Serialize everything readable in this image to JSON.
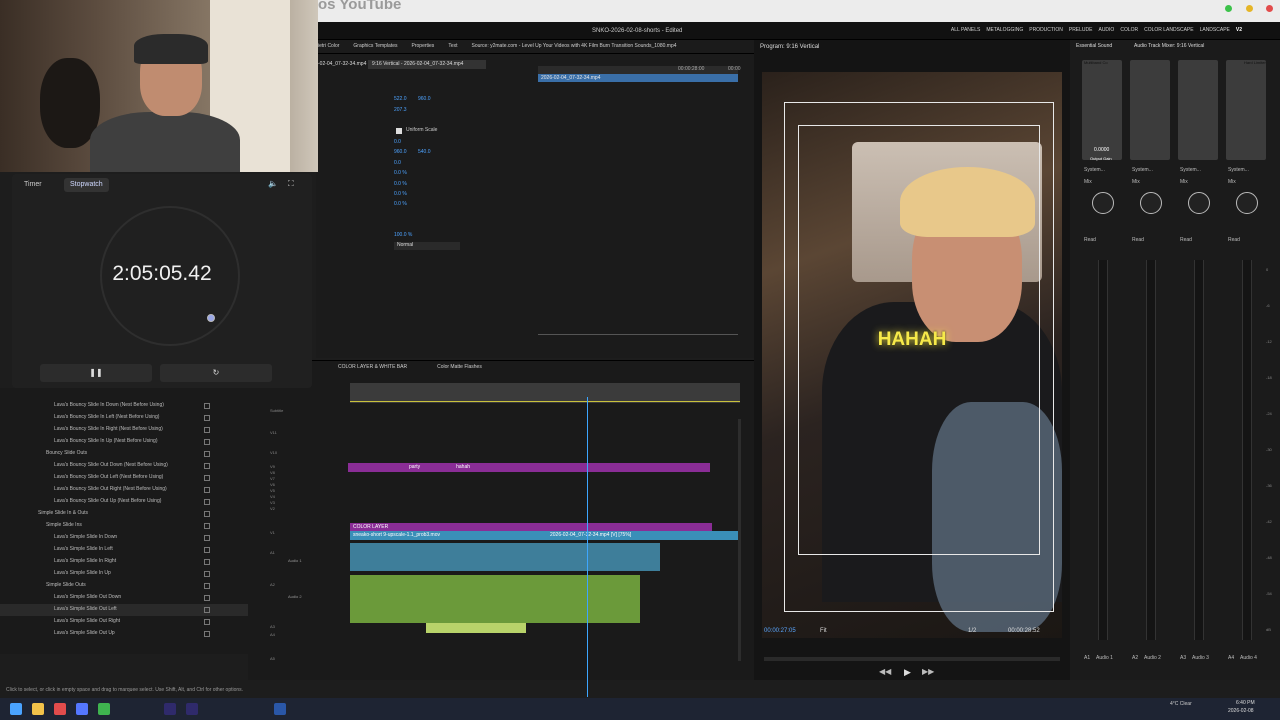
{
  "browser": {
    "tab_title": "os YouTube"
  },
  "app": {
    "title": "SNKO-2026-02-08-shorts - Edited",
    "workspaces": [
      "ALL PANELS",
      "METALOGGING",
      "PRODUCTION",
      "PRELUDE",
      "AUDIO",
      "COLOR",
      "COLOR LANDSCAPE",
      "LANDSCAPE",
      "V2"
    ]
  },
  "timer_widget": {
    "tab_timer": "Timer",
    "tab_stopwatch": "Stopwatch",
    "time": "2:05:05.42",
    "pause_icon": "pause-icon",
    "reset_icon": "reset-icon"
  },
  "effects_panel": {
    "items": [
      {
        "label": "Lava's Bouncy Slide In Down (Nest Before Using)",
        "indent": 2
      },
      {
        "label": "Lava's Bouncy Slide In Left (Nest Before Using)",
        "indent": 2
      },
      {
        "label": "Lava's Bouncy Slide In Right (Nest Before Using)",
        "indent": 2
      },
      {
        "label": "Lava's Bouncy Slide In Up (Nest Before Using)",
        "indent": 2
      },
      {
        "label": "Bouncy Slide Outs",
        "indent": 1
      },
      {
        "label": "Lava's Bouncy Slide Out Down (Nest Before Using)",
        "indent": 2
      },
      {
        "label": "Lava's Bouncy Slide Out Left (Nest Before Using)",
        "indent": 2
      },
      {
        "label": "Lava's Bouncy Slide Out Right (Nest Before Using)",
        "indent": 2
      },
      {
        "label": "Lava's Bouncy Slide Out Up (Nest Before Using)",
        "indent": 2
      },
      {
        "label": "Simple Slide In & Outs",
        "indent": 0
      },
      {
        "label": "Simple Slide Ins",
        "indent": 1
      },
      {
        "label": "Lava's Simple Slide In Down",
        "indent": 2
      },
      {
        "label": "Lava's Simple Slide In Left",
        "indent": 2
      },
      {
        "label": "Lava's Simple Slide In Right",
        "indent": 2
      },
      {
        "label": "Lava's Simple Slide In Up",
        "indent": 2
      },
      {
        "label": "Simple Slide Outs",
        "indent": 1
      },
      {
        "label": "Lava's Simple Slide Out Down",
        "indent": 2
      },
      {
        "label": "Lava's Simple Slide Out Left",
        "indent": 2
      },
      {
        "label": "Lava's Simple Slide Out Right",
        "indent": 2
      },
      {
        "label": "Lava's Simple Slide Out Up",
        "indent": 2
      }
    ]
  },
  "effect_controls": {
    "tabs": [
      "ietri Color",
      "Graphics Templates",
      "Properties",
      "Text",
      "Source: y2mate.com - Level Up Your Videos with 4K Film Burn Transition Sounds_1080.mp4"
    ],
    "clip_path": "9:16 Vertical - 2026-02-04_07-32-34.mp4",
    "clip_short": "-02-04_07-32-34.mp4",
    "mini_clip": "2026-02-04_07-32-34.mp4",
    "mini_times": [
      "00:00:28:00",
      "00:00"
    ],
    "values": [
      "522.0",
      "960.0",
      "207.3",
      "Uniform Scale",
      "0.0",
      "960.0",
      "540.0",
      "0.0",
      "0.0 %",
      "0.0 %",
      "0.0 %",
      "0.0 %",
      "100.0 %",
      "Normal"
    ]
  },
  "timeline": {
    "tabs": [
      "COLOR LAYER & WHITE BAR",
      "Color Matte Flashes"
    ],
    "tracks": [
      "Subtitle",
      "V11",
      "V10",
      "V9",
      "V8",
      "V7",
      "V6",
      "V5",
      "V4",
      "V3",
      "V2",
      "V1",
      "A1",
      "A2",
      "A3",
      "A4",
      "A5"
    ],
    "track_labels": [
      "Audio 1",
      "Audio 2"
    ],
    "clips": {
      "party": "party",
      "hahah": "hahah",
      "color_layer": "COLOR LAYER",
      "main_left": "sneako-short 9-upscale-1.1_prob3.mov",
      "main_right": "2026-02-04_07-32-34.mp4 [V] [75%]"
    }
  },
  "program_monitor": {
    "title": "Program: 9:16 Vertical",
    "caption": "HAHAH",
    "timecode": "00:00:27:05",
    "zoom": "Fit",
    "quality": "1/2",
    "duration": "00:00:28:52"
  },
  "mixer": {
    "tabs": [
      "Essential Sound",
      "Audio Track Mixer: 9:16 Vertical"
    ],
    "channel_labels": [
      "Multiband Co",
      "Hard Limiter"
    ],
    "gain_value": "0.0000",
    "output_gain": "Output Gain",
    "inputs": [
      "System...",
      "System...",
      "System...",
      "System..."
    ],
    "modes": [
      "Mix",
      "Mix",
      "Mix",
      "Mix"
    ],
    "read": [
      "Read",
      "Read",
      "Read",
      "Read"
    ],
    "tracks": [
      "A1",
      "Audio 1",
      "A2",
      "Audio 2",
      "A3",
      "Audio 3",
      "A4",
      "Audio 4"
    ],
    "scale": [
      "0",
      "-6",
      "-12",
      "-18",
      "-24",
      "-30",
      "-36",
      "-42",
      "-48",
      "-54",
      "dB"
    ]
  },
  "status_bar": {
    "hint": "Click to select, or click in empty space and drag to marquee select. Use Shift, Alt, and Ctrl for other options."
  },
  "taskbar": {
    "weather": "4°C Clear",
    "time": "6:40 PM",
    "date": "2026-02-08"
  }
}
